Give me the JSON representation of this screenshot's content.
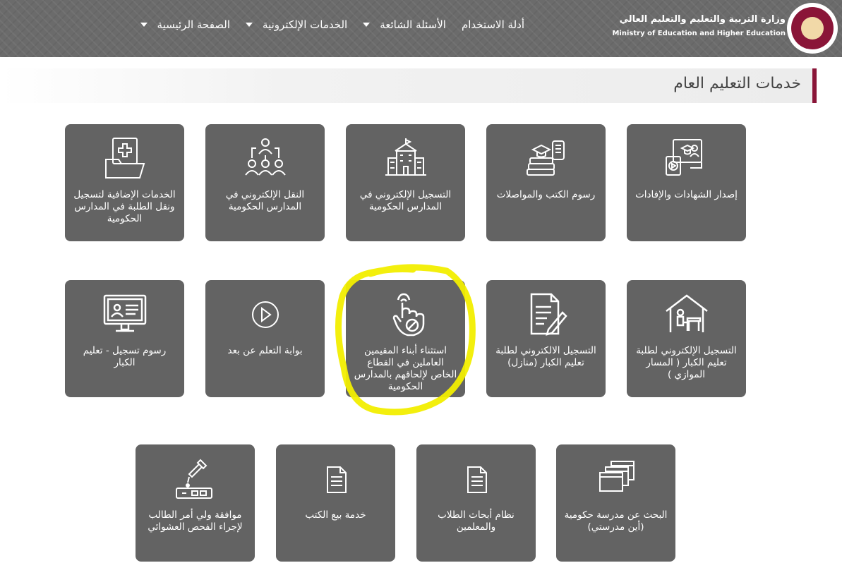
{
  "header": {
    "ministry_ar": "وزارة التربية والتعليم والتعليم العالي",
    "ministry_en": "Ministry of Education and Higher Education",
    "nav": [
      {
        "label": "الصفحة الرئيسية"
      },
      {
        "label": "الخدمات الإلكترونية"
      },
      {
        "label": "الأسئلة الشائعة"
      },
      {
        "label": "أدلة الاستخدام"
      }
    ]
  },
  "section": {
    "title": "خدمات التعليم العام"
  },
  "tiles": [
    {
      "label": "إصدار الشهادات والإفادات",
      "icon": "certificate-monitor-icon"
    },
    {
      "label": "رسوم الكتب والمواصلات",
      "icon": "books-icon"
    },
    {
      "label": "التسجيل الإلكتروني في المدارس الحكومية",
      "icon": "school-building-icon"
    },
    {
      "label": "النقل الإلكتروني في المدارس الحكومية",
      "icon": "people-transfer-icon"
    },
    {
      "label": "الخدمات الإضافية لتسجيل ونقل الطلبة في المدارس الحكومية",
      "icon": "folder-docs-icon"
    },
    {
      "label": "التسجيل الإلكتروني لطلبة تعليم الكبار ( المسار الموازي )",
      "icon": "house-study-icon"
    },
    {
      "label": "التسجيل الالكتروني لطلبة تعليم الكبار (منازل)",
      "icon": "document-pen-icon"
    },
    {
      "label": "استثناء أبناء المقيمين العاملين في القطاع الخاص لإلحاقهم بالمدارس الحكومية",
      "icon": "hand-pointer-icon"
    },
    {
      "label": "بوابة التعلم عن بعد",
      "icon": "play-circle-icon"
    },
    {
      "label": "رسوم تسجيل - تعليم الكبار",
      "icon": "monitor-id-icon"
    },
    {
      "label": "البحث عن مدرسة حكومية (أين مدرستي)",
      "icon": "windows-icon"
    },
    {
      "label": "نظام أبحاث الطلاب والمعلمين",
      "icon": "document-icon"
    },
    {
      "label": "خدمة بيع الكتب",
      "icon": "document-icon"
    },
    {
      "label": "موافقة ولي أمر الطالب لإجراء الفحص العشوائي",
      "icon": "test-kit-icon"
    }
  ],
  "colors": {
    "brand": "#8a1538",
    "tile": "#636363",
    "highlight": "#f2ee00"
  }
}
